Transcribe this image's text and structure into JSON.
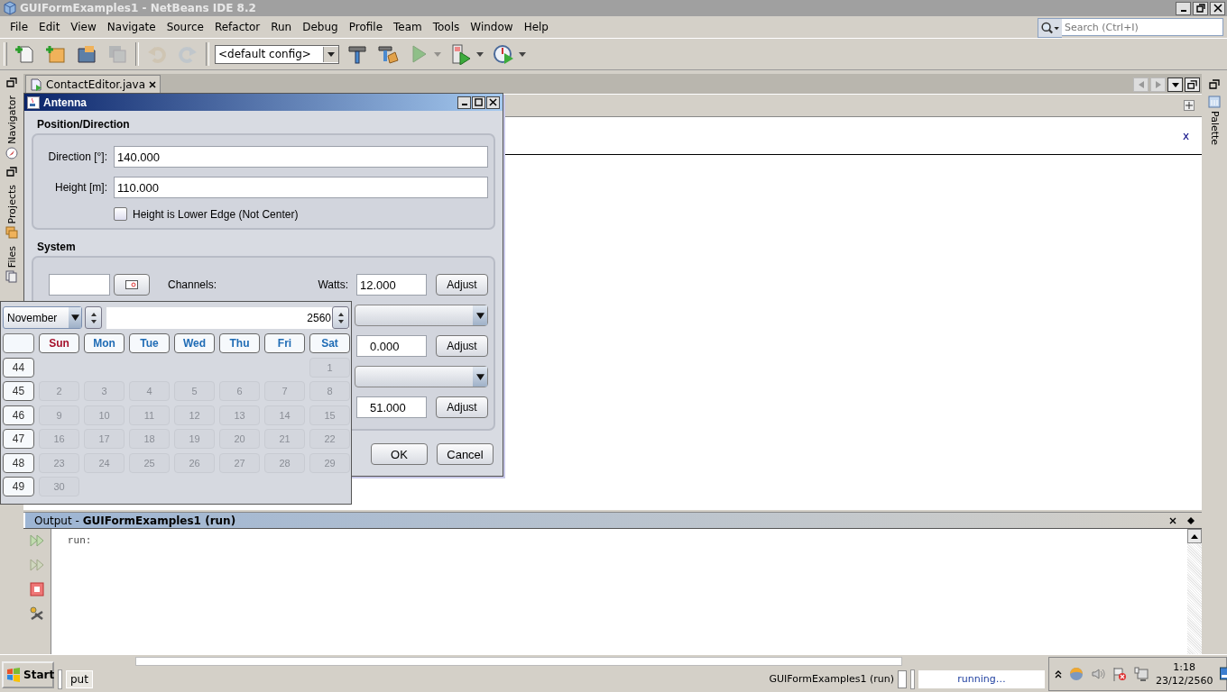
{
  "window": {
    "title": "GUIFormExamples1 - NetBeans IDE 8.2"
  },
  "menu": [
    "File",
    "Edit",
    "View",
    "Navigate",
    "Source",
    "Refactor",
    "Run",
    "Debug",
    "Profile",
    "Team",
    "Tools",
    "Window",
    "Help"
  ],
  "search": {
    "placeholder": "Search (Ctrl+I)"
  },
  "toolbar": {
    "buttons": [
      {
        "kind": "new-file",
        "disabled": false,
        "dropdown": false
      },
      {
        "kind": "new-project",
        "disabled": false,
        "dropdown": false
      },
      {
        "kind": "open-project",
        "disabled": false,
        "dropdown": false
      },
      {
        "kind": "save-all",
        "disabled": true,
        "dropdown": false
      },
      {
        "kind": "undo",
        "disabled": true,
        "dropdown": false
      },
      {
        "kind": "redo",
        "disabled": true,
        "dropdown": false
      },
      {
        "kind": "config",
        "disabled": false
      },
      {
        "kind": "build",
        "disabled": false,
        "dropdown": false
      },
      {
        "kind": "clean-build",
        "disabled": false,
        "dropdown": false
      },
      {
        "kind": "run",
        "disabled": true,
        "dropdown": true
      },
      {
        "kind": "debug",
        "disabled": false,
        "dropdown": true
      },
      {
        "kind": "profile",
        "disabled": false,
        "dropdown": true
      }
    ],
    "config": "<default config>"
  },
  "left_strip": [
    "Navigator",
    "Projects",
    "Files"
  ],
  "right_strip": [
    "Palette"
  ],
  "editor": {
    "tab": "ContactEditor.java",
    "canvas_mark": "x"
  },
  "dialog": {
    "title": "Antenna",
    "position_group": {
      "title": "Position/Direction",
      "fields": [
        {
          "label": "Direction [°]:",
          "value": "140.000"
        },
        {
          "label": "Height [m]:",
          "value": "110.000"
        }
      ],
      "checkbox": {
        "label": "Height is Lower Edge (Not Center)",
        "checked": false
      }
    },
    "system_group": {
      "title": "System",
      "channels_label": "Channels:",
      "watts_label": "Watts:",
      "rows": [
        {
          "kind": "field",
          "value": "12.000",
          "button": "Adjust"
        },
        {
          "kind": "combo"
        },
        {
          "kind": "field",
          "value": "0.000",
          "button": "Adjust"
        },
        {
          "kind": "combo"
        },
        {
          "kind": "field",
          "value": "51.000",
          "button": "Adjust"
        }
      ]
    },
    "buttons": [
      "OK",
      "Cancel"
    ]
  },
  "calendar": {
    "month": "November",
    "year": "2560",
    "days_disabled": true,
    "day_headers": [
      {
        "label": "Sun",
        "color": "#a5102b"
      },
      {
        "label": "Mon",
        "color": "#1f6cb5"
      },
      {
        "label": "Tue",
        "color": "#1f6cb5"
      },
      {
        "label": "Wed",
        "color": "#1f6cb5"
      },
      {
        "label": "Thu",
        "color": "#1f6cb5"
      },
      {
        "label": "Fri",
        "color": "#1f6cb5"
      },
      {
        "label": "Sat",
        "color": "#1f6cb5"
      }
    ],
    "weeks": [
      {
        "week": "44",
        "days": [
          "1"
        ]
      },
      {
        "week": "45",
        "days": [
          "2",
          "3",
          "4",
          "5",
          "6",
          "7",
          "8"
        ]
      },
      {
        "week": "46",
        "days": [
          "9",
          "10",
          "11",
          "12",
          "13",
          "14",
          "15"
        ]
      },
      {
        "week": "47",
        "days": [
          "16",
          "17",
          "18",
          "19",
          "20",
          "21",
          "22"
        ]
      },
      {
        "week": "48",
        "days": [
          "23",
          "24",
          "25",
          "26",
          "27",
          "28",
          "29"
        ]
      },
      {
        "week": "49",
        "days": [
          "30"
        ]
      }
    ]
  },
  "output": {
    "title": "Output - **GUIFormExamples1 (run)**",
    "text": "run:"
  },
  "taskbar": {
    "start": "Start",
    "task": "put",
    "status": "GUIFormExamples1 (run)",
    "progress": "running…",
    "time": "1:18",
    "date": "23/12/2560"
  }
}
